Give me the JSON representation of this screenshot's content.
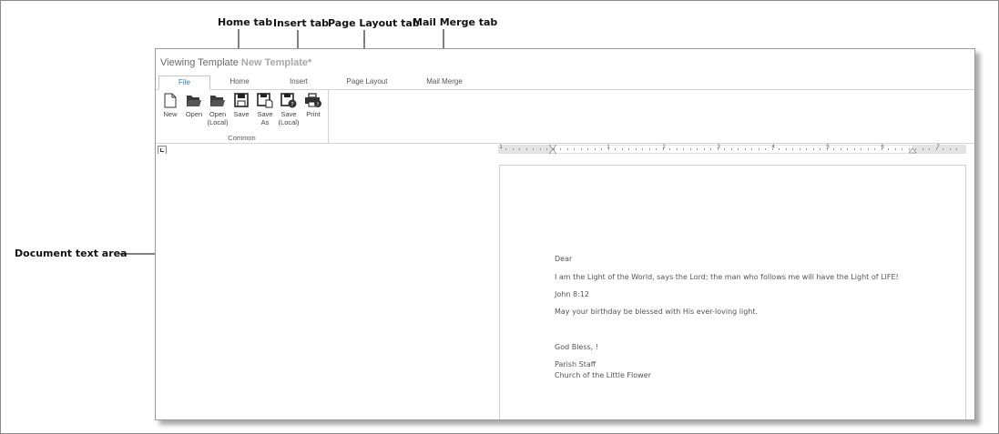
{
  "annotations": {
    "home_tab": "Home tab",
    "insert_tab": "Insert tab",
    "page_layout_tab": "Page Layout tab",
    "mail_merge_tab": "Mail Merge tab",
    "document_text_area": "Document text area"
  },
  "window": {
    "title_prefix": "Viewing Template",
    "template_name": "New Template*"
  },
  "tabs": [
    {
      "label": "File",
      "active": true
    },
    {
      "label": "Home",
      "active": false
    },
    {
      "label": "Insert",
      "active": false
    },
    {
      "label": "Page Layout",
      "active": false
    },
    {
      "label": "Mail Merge",
      "active": false
    }
  ],
  "ribbon": {
    "group_label": "Common",
    "buttons": [
      {
        "label_line1": "New",
        "label_line2": "",
        "icon": "new-document-icon"
      },
      {
        "label_line1": "Open",
        "label_line2": "",
        "icon": "folder-open-icon"
      },
      {
        "label_line1": "Open",
        "label_line2": "(Local)",
        "icon": "folder-open-local-icon"
      },
      {
        "label_line1": "Save",
        "label_line2": "",
        "icon": "save-icon"
      },
      {
        "label_line1": "Save",
        "label_line2": "As",
        "icon": "save-as-icon"
      },
      {
        "label_line1": "Save",
        "label_line2": "(Local)",
        "icon": "save-local-icon"
      },
      {
        "label_line1": "Print",
        "label_line2": "",
        "icon": "print-icon"
      }
    ]
  },
  "ruler": {
    "labels": [
      "1",
      "1",
      "2",
      "3",
      "4",
      "5",
      "6",
      "7"
    ]
  },
  "document": {
    "lines": [
      "Dear",
      "I am the Light of the World, says the Lord; the man who follows me will have the Light of LIFE!",
      "John 8:12",
      "May your birthday be blessed with His ever-loving light.",
      "God Bless,  !",
      "Parish Staff",
      "Church of the Little Flower"
    ]
  }
}
